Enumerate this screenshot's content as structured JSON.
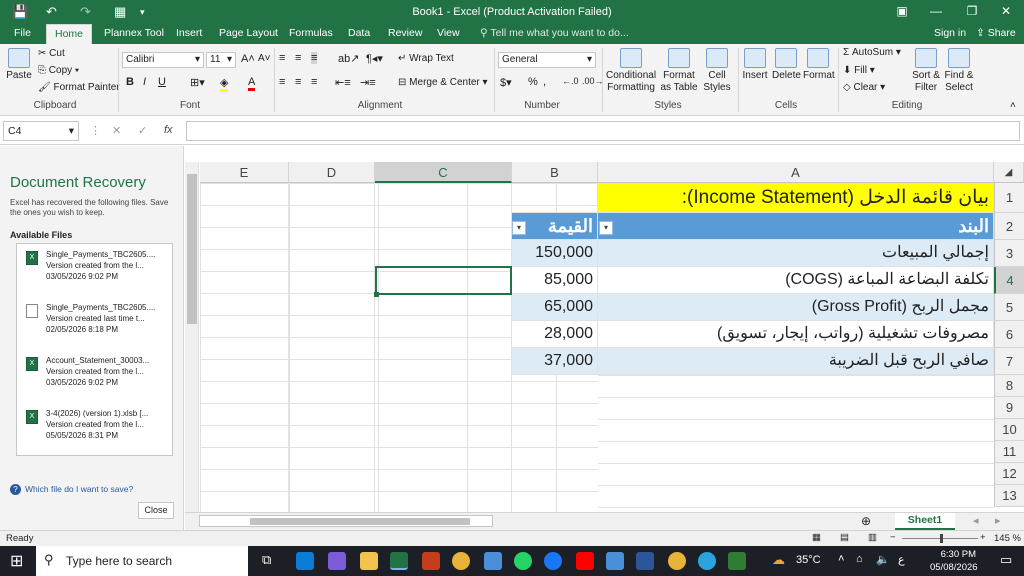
{
  "window": {
    "title": "Book1 - Excel (Product Activation Failed)"
  },
  "tabs": [
    "File",
    "Home",
    "Plannex Tool",
    "Insert",
    "Page Layout",
    "Formulas",
    "Data",
    "Review",
    "View"
  ],
  "tell_me": "Tell me what you want to do...",
  "account": {
    "signin": "Sign in",
    "share": "Share"
  },
  "ribbon": {
    "clipboard": {
      "label": "Clipboard",
      "paste": "Paste",
      "cut": "Cut",
      "copy": "Copy",
      "format_painter": "Format Painter"
    },
    "font": {
      "label": "Font",
      "name": "Calibri",
      "size": "11"
    },
    "alignment": {
      "label": "Alignment",
      "wrap": "Wrap Text",
      "merge": "Merge & Center"
    },
    "number": {
      "label": "Number",
      "format": "General"
    },
    "styles": {
      "label": "Styles",
      "conditional": "Conditional Formatting",
      "format_table": "Format as Table",
      "cell_styles": "Cell Styles"
    },
    "cells": {
      "label": "Cells",
      "insert": "Insert",
      "delete": "Delete",
      "format": "Format"
    },
    "editing": {
      "label": "Editing",
      "autosum": "AutoSum",
      "fill": "Fill",
      "clear": "Clear",
      "sort": "Sort & Filter",
      "find": "Find & Select"
    }
  },
  "formula_bar": {
    "name_box": "C4",
    "fx": "fx",
    "content": ""
  },
  "recovery": {
    "title": "Document Recovery",
    "description": "Excel has recovered the following files. Save the ones you wish to keep.",
    "available": "Available Files",
    "files": [
      {
        "name": "Single_Payments_TBC2605....",
        "line2": "Version created from the l...",
        "date": "03/05/2026 9:02 PM",
        "icon": "excel-icon"
      },
      {
        "name": "Single_Payments_TBC2605....",
        "line2": "Version created last time t...",
        "date": "02/05/2026 8:18 PM",
        "icon": "document-icon"
      },
      {
        "name": "Account_Statement_30003...",
        "line2": "Version created from the l...",
        "date": "03/05/2026 9:02 PM",
        "icon": "excel-icon"
      },
      {
        "name": "3-4(2026) (version 1).xlsb  [...",
        "line2": "Version created from the l...",
        "date": "05/05/2026 8:31 PM",
        "icon": "excel-icon"
      }
    ],
    "help": "Which file do I want to save?",
    "close": "Close"
  },
  "sheet": {
    "columns": [
      "A",
      "B",
      "C",
      "D",
      "E"
    ],
    "rows": [
      "1",
      "2",
      "3",
      "4",
      "5",
      "6",
      "7",
      "8",
      "9",
      "10",
      "11",
      "12",
      "13"
    ],
    "title": "بيان قائمة الدخل (Income Statement):",
    "header_item": "البند",
    "header_value": "القيمة",
    "data": [
      {
        "item": "إجمالي المبيعات",
        "value": "150,000"
      },
      {
        "item": "تكلفة البضاعة المباعة (COGS)",
        "value": "85,000"
      },
      {
        "item": "مجمل الربح (Gross Profit)",
        "value": "65,000"
      },
      {
        "item": "مصروفات تشغيلية (رواتب، إيجار، تسويق)",
        "value": "28,000"
      },
      {
        "item": "صافي الربح قبل الضريبة",
        "value": "37,000"
      }
    ],
    "tab": "Sheet1"
  },
  "status": {
    "ready": "Ready",
    "zoom": "145 %"
  },
  "taskbar": {
    "search": "Type here to search",
    "weather": "35°C",
    "time": "6:30 PM",
    "date": "05/08/2026",
    "lang": "ع"
  }
}
